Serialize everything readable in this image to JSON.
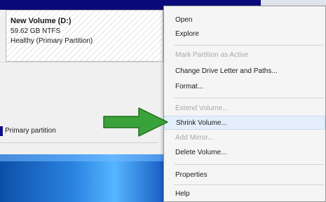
{
  "volume": {
    "name": "New Volume  (D:)",
    "size": "59.62 GB NTFS",
    "status": "Healthy (Primary Partition)"
  },
  "legend": {
    "label": "Primary partition"
  },
  "context_menu": {
    "items": [
      {
        "label": "Open",
        "enabled": true
      },
      {
        "label": "Explore",
        "enabled": true
      },
      {
        "label": "Mark Partition as Active",
        "enabled": false
      },
      {
        "label": "Change Drive Letter and Paths...",
        "enabled": true
      },
      {
        "label": "Format...",
        "enabled": true
      },
      {
        "label": "Extend Volume...",
        "enabled": false
      },
      {
        "label": "Shrink Volume...",
        "enabled": true,
        "highlighted": true
      },
      {
        "label": "Add Mirror...",
        "enabled": false
      },
      {
        "label": "Delete Volume...",
        "enabled": true
      },
      {
        "label": "Properties",
        "enabled": true
      },
      {
        "label": "Help",
        "enabled": true
      }
    ]
  },
  "pointer": {
    "icon": "green-arrow-icon",
    "color": "#3aa23a"
  },
  "colors": {
    "title_bar": "#0a0a7a",
    "highlight": "#e5effb",
    "disabled_text": "#a8a8a8"
  }
}
